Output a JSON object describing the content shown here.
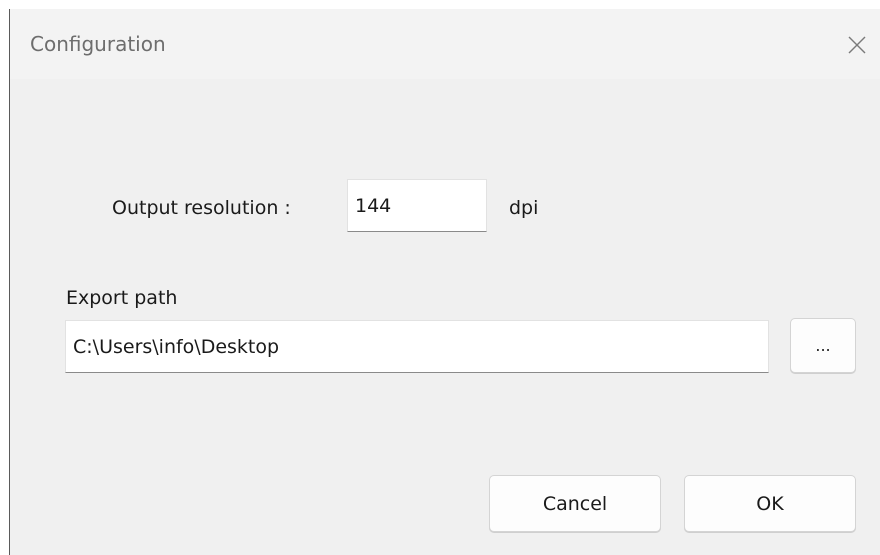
{
  "window": {
    "title": "Configuration",
    "close_icon": "close-icon"
  },
  "resolution": {
    "label": "Output resolution :",
    "value": "144",
    "unit": "dpi"
  },
  "export": {
    "label": "Export path",
    "value": "C:\\Users\\info\\Desktop",
    "browse_label": "..."
  },
  "actions": {
    "cancel_label": "Cancel",
    "ok_label": "OK"
  }
}
